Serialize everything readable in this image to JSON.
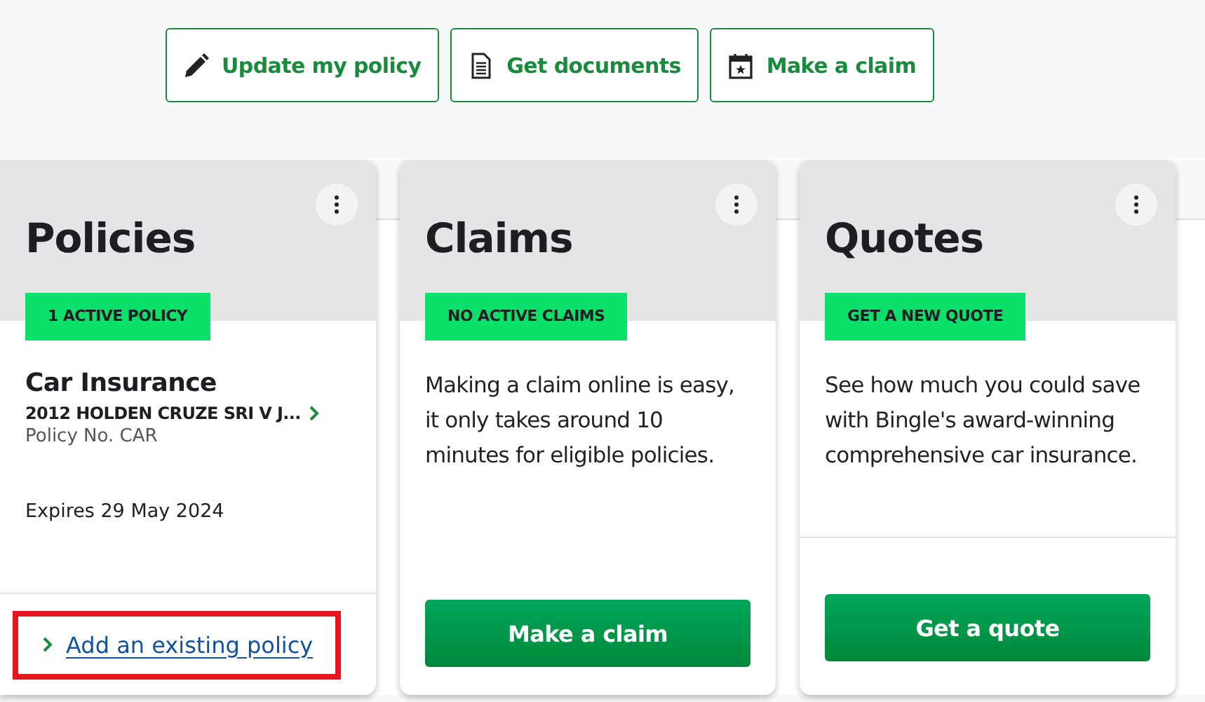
{
  "action_buttons": [
    {
      "label": "Update my policy",
      "kind": "pencil"
    },
    {
      "label": "Get documents",
      "kind": "document"
    },
    {
      "label": "Make a claim",
      "kind": "calendar"
    }
  ],
  "cards": [
    {
      "kind": "policies",
      "title": "Policies",
      "badge": "1 ACTIVE POLICY",
      "policy": {
        "name": "Car Insurance",
        "vehicle": "2012 HOLDEN CRUZE SRI V J...",
        "number": "Policy No. CAR",
        "expiry": "Expires 29 May 2024"
      },
      "link": {
        "label": "Add an existing policy",
        "highlighted": true
      }
    },
    {
      "kind": "claims",
      "title": "Claims",
      "badge": "NO ACTIVE CLAIMS",
      "text": "Making a claim online is easy, it only takes around 10 minutes for eligible policies.",
      "button": "Make a claim"
    },
    {
      "kind": "quotes",
      "title": "Quotes",
      "badge": "GET A NEW QUOTE",
      "text": "See how much you could save with Bingle's award-winning comprehensive car insurance.",
      "button": "Get a quote"
    }
  ]
}
